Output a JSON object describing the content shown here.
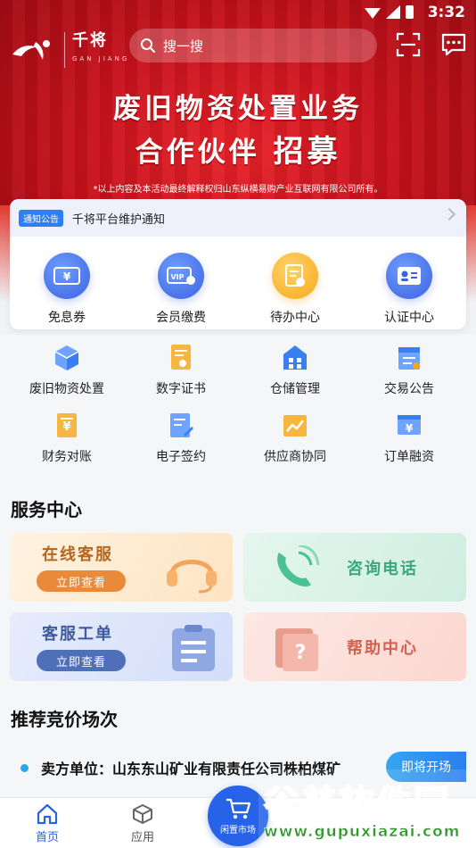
{
  "status_bar": {
    "time": "3:32"
  },
  "header": {
    "logo_name": "千将",
    "logo_sub": "GAN JIANG",
    "search_label": "搜一搜"
  },
  "banner": {
    "line1": "废旧物资处置业务",
    "line2_a": "合作伙伴",
    "line2_b": "招募",
    "note": "*以上内容及本活动最终解释权归山东纵横易购产业互联网有限公司所有。"
  },
  "notice": {
    "badge": "通知公告",
    "text": "千将平台维护通知"
  },
  "quick_actions": [
    {
      "label": "免息券",
      "icon": "ticket-icon"
    },
    {
      "label": "会员缴费",
      "icon": "vip-card-icon"
    },
    {
      "label": "待办中心",
      "icon": "todo-list-icon"
    },
    {
      "label": "认证中心",
      "icon": "id-card-icon"
    }
  ],
  "grid": [
    {
      "label": "废旧物资处置",
      "icon": "box-icon",
      "color": "#3a7ff0"
    },
    {
      "label": "数字证书",
      "icon": "certificate-icon",
      "color": "#f5a524"
    },
    {
      "label": "仓储管理",
      "icon": "warehouse-icon",
      "color": "#3a7ff0"
    },
    {
      "label": "交易公告",
      "icon": "announcement-icon",
      "color": "#3a7ff0"
    },
    {
      "label": "财务对账",
      "icon": "finance-icon",
      "color": "#f5a524"
    },
    {
      "label": "电子签约",
      "icon": "e-sign-icon",
      "color": "#3a7ff0"
    },
    {
      "label": "供应商协同",
      "icon": "chart-icon",
      "color": "#f5a524"
    },
    {
      "label": "订单融资",
      "icon": "order-finance-icon",
      "color": "#3a7ff0"
    }
  ],
  "service_center": {
    "title": "服务中心",
    "cards": [
      {
        "title": "在线客服",
        "button": "立即查看",
        "icon": "headset-icon"
      },
      {
        "title": "咨询电话",
        "icon": "phone-icon"
      },
      {
        "title": "客服工单",
        "button": "立即查看",
        "icon": "clipboard-icon"
      },
      {
        "title": "帮助中心",
        "icon": "help-book-icon"
      }
    ]
  },
  "auction": {
    "title": "推荐竞价场次",
    "item_text": "卖方单位：山东东山矿业有限责任公司株柏煤矿",
    "status_button": "即将开场"
  },
  "bottom_nav": {
    "home": "首页",
    "apps": "应用",
    "center": "闲置市场"
  },
  "watermark": {
    "main": "谷普软件园",
    "url": "www.gupuxiazai.com"
  },
  "colors": {
    "brand_red": "#c8121c",
    "primary_blue": "#2663e8",
    "accent_orange": "#f5a524"
  }
}
